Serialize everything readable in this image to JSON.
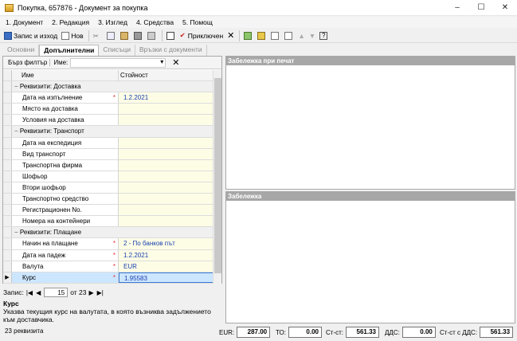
{
  "window": {
    "title": "Покупка, 657876 - Документ за покупка",
    "min": "–",
    "max": "☐",
    "close": "✕"
  },
  "menu": [
    "1. Документ",
    "2. Редакция",
    "3. Изглед",
    "4. Средства",
    "5. Помощ"
  ],
  "toolbar": {
    "record_exit": "Запис и изход",
    "new": "Нов",
    "complete": "Приключен"
  },
  "tabs": [
    "Основни",
    "Допълнителни",
    "Списъци",
    "Връзки с документи"
  ],
  "filter": {
    "quick": "Бърз филтър",
    "name_label": "Име:",
    "clear": "✕"
  },
  "grid": {
    "col_name": "Име",
    "col_value": "Стойност",
    "groups": [
      {
        "title": "Реквизити: Доставка",
        "rows": [
          {
            "name": "Дата на изпълнение",
            "value": "1.2.2021",
            "req": "*"
          },
          {
            "name": "Място на доставка",
            "value": "",
            "req": ""
          },
          {
            "name": "Условия на доставка",
            "value": "",
            "req": ""
          }
        ]
      },
      {
        "title": "Реквизити: Транспорт",
        "rows": [
          {
            "name": "Дата на експедиция",
            "value": "",
            "req": ""
          },
          {
            "name": "Вид транспорт",
            "value": "",
            "req": ""
          },
          {
            "name": "Транспортна фирма",
            "value": "",
            "req": ""
          },
          {
            "name": "Шофьор",
            "value": "",
            "req": ""
          },
          {
            "name": "Втори шофьор",
            "value": "",
            "req": ""
          },
          {
            "name": "Транспортно средство",
            "value": "",
            "req": ""
          },
          {
            "name": "Регистрационен No.",
            "value": "",
            "req": ""
          },
          {
            "name": "Номера на контейнери",
            "value": "",
            "req": ""
          }
        ]
      },
      {
        "title": "Реквизити: Плащане",
        "rows": [
          {
            "name": "Начин на плащане",
            "value": "2 - По банков път",
            "req": "*"
          },
          {
            "name": "Дата на падеж",
            "value": "1.2.2021",
            "req": "*"
          },
          {
            "name": "Валута",
            "value": "EUR",
            "req": "*"
          },
          {
            "name": "Курс",
            "value": "1.95583",
            "req": "*"
          }
        ]
      }
    ]
  },
  "nav": {
    "label": "Запис:",
    "current": "15",
    "total": "от 23"
  },
  "description": {
    "title": "Курс",
    "text": "Указва текущия курс на валутата, в която възниква задължението към доставчика."
  },
  "panels": {
    "print_note": "Забележка при печат",
    "note": "Забележка"
  },
  "status": {
    "count": "23 реквизита"
  },
  "totals": [
    {
      "label": "EUR:",
      "value": "287.00"
    },
    {
      "label": "ТО:",
      "value": "0.00"
    },
    {
      "label": "Ст-ст:",
      "value": "561.33"
    },
    {
      "label": "ДДС:",
      "value": "0.00"
    },
    {
      "label": "Ст-ст с ДДС:",
      "value": "561.33"
    }
  ]
}
